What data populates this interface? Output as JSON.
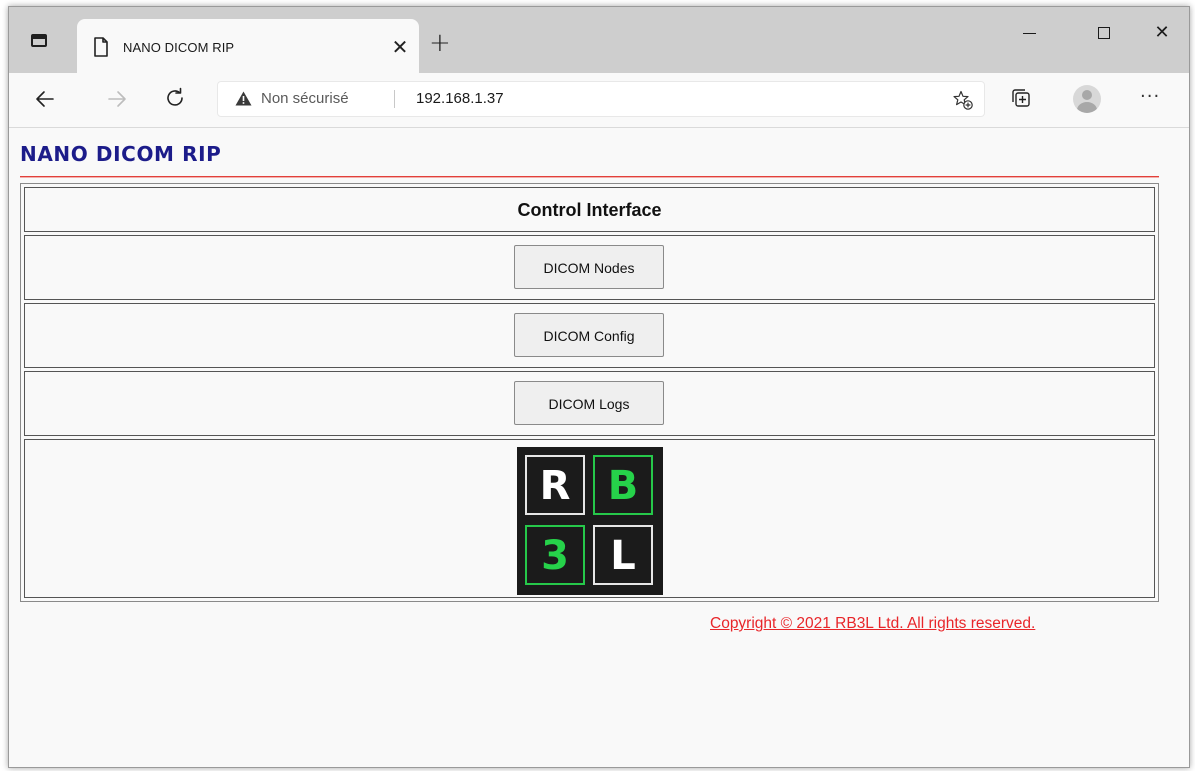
{
  "browser": {
    "tab": {
      "title": "NANO DICOM RIP",
      "close_label": "✕"
    },
    "new_tab_label": "+",
    "window_controls": {
      "minimize": "minimize",
      "maximize": "maximize",
      "close": "✕"
    },
    "address_bar": {
      "security_label": "Non sécurisé",
      "url": "192.168.1.37"
    },
    "menu_label": "···",
    "icons": [
      "tab-actions-icon",
      "page-icon",
      "back-arrow-icon",
      "forward-arrow-icon",
      "reload-icon",
      "warning-icon",
      "add-favorite-icon",
      "collections-icon",
      "profile-icon",
      "more-menu-icon"
    ]
  },
  "page": {
    "title": "NANO DICOM RIP",
    "colors": {
      "title": "#1c1c8a",
      "rule": "#e2403a",
      "link": "#e8262a",
      "logo_green": "#26d24a"
    },
    "panel": {
      "header": "Control Interface",
      "buttons": [
        "DICOM Nodes",
        "DICOM Config",
        "DICOM Logs"
      ]
    },
    "logo": {
      "letters": [
        "R",
        "B",
        "3",
        "L"
      ]
    },
    "footer": {
      "copyright": "Copyright © 2021 RB3L Ltd. All rights reserved."
    }
  }
}
